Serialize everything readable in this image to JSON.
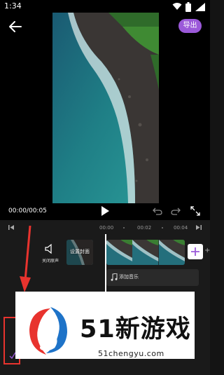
{
  "status_bar": {
    "time": "1:34",
    "icons": [
      "wifi-icon",
      "battery-icon",
      "signal-icon"
    ]
  },
  "top_bar": {
    "back_icon": "back-arrow-icon",
    "export_label": "导出",
    "export_color": "#9b59d9"
  },
  "player": {
    "time_display": "00:00/00:05",
    "play_icon": "play-icon",
    "undo_icon": "undo-icon",
    "redo_icon": "redo-icon",
    "fullscreen_icon": "fullscreen-icon"
  },
  "timeline": {
    "ticks": [
      "00:00",
      "00:02",
      "00:04"
    ],
    "mute_label": "关闭原声",
    "cover_label": "设置封面",
    "add_music_label": "添加音乐",
    "add_clip_extra": "+"
  },
  "annotation": {
    "color": "#e8332e"
  },
  "watermark": {
    "title": "51新游戏",
    "url": "51chengyu.com"
  }
}
